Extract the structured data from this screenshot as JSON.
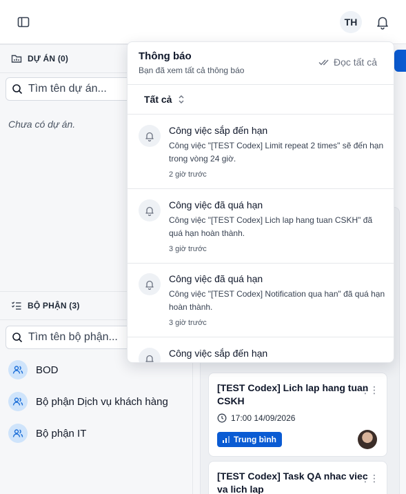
{
  "topbar": {
    "avatar_initials": "TH"
  },
  "sidebar": {
    "projects_header": "DỰ ÁN (0)",
    "projects_search_placeholder": "Tìm tên dự án...",
    "projects_empty": "Chưa có dự án.",
    "departments_header": "BỘ PHẬN (3)",
    "departments_search_placeholder": "Tìm tên bộ phận...",
    "departments": [
      {
        "label": "BOD"
      },
      {
        "label": "Bộ phận Dịch vụ khách hàng"
      },
      {
        "label": "Bộ phận IT"
      }
    ]
  },
  "notifications": {
    "title": "Thông báo",
    "subtitle": "Bạn đã xem tất cả thông báo",
    "mark_all_label": "Đọc tất cả",
    "filter_label": "Tất cả",
    "items": [
      {
        "title": "Công việc sắp đến hạn",
        "body": "Công việc \"[TEST Codex] Limit repeat 2 times\" sẽ đến hạn trong vòng 24 giờ.",
        "time": "2 giờ trước"
      },
      {
        "title": "Công việc đã quá hạn",
        "body": "Công việc \"[TEST Codex] Lich lap hang tuan CSKH\" đã quá hạn hoàn thành.",
        "time": "3 giờ trước"
      },
      {
        "title": "Công việc đã quá hạn",
        "body": "Công việc \"[TEST Codex] Notification qua han\" đã quá hạn hoàn thành.",
        "time": "3 giờ trước"
      },
      {
        "title": "Công việc sắp đến hạn",
        "body": "",
        "time": ""
      }
    ]
  },
  "cards": [
    {
      "title": "[TEST Codex] Lich lap hang tuan CSKH",
      "date": "17:00 14/09/2026",
      "priority": "Trung bình"
    },
    {
      "title": "[TEST Codex] Task QA nhac viec va lich lap"
    }
  ],
  "colors": {
    "accent": "#0a5bd3",
    "dept_icon_bg": "#cfe4fb"
  }
}
